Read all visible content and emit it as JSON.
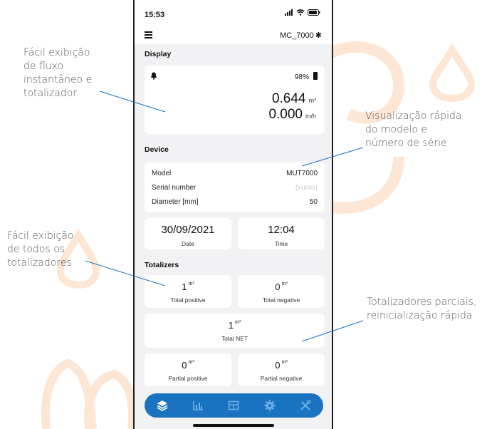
{
  "annotations": {
    "flow": "Fácil exibição\nde fluxo\ninstantâneo e\ntotalizador",
    "model": "Visualização rápida\ndo modelo e\nnúmero de série",
    "totalizers": "Fácil exibição\nde todos os\ntotalizadores",
    "partial": "Totalizadores parciais,\nreinicialização rápida"
  },
  "status": {
    "time": "15:53"
  },
  "appbar": {
    "device_id": "MC_7000"
  },
  "display": {
    "title": "Display",
    "battery": "98%",
    "volume": "0.644",
    "volume_unit": "m³",
    "flow": "0.000",
    "flow_unit": "m/h"
  },
  "device": {
    "title": "Device",
    "model_label": "Model",
    "model_value": "MUT7000",
    "serial_label": "Serial number",
    "serial_value": "(vuoto)",
    "diameter_label": "Diameter [mm]",
    "diameter_value": "50",
    "date_value": "30/09/2021",
    "date_label": "Date",
    "time_value": "12:04",
    "time_label": "Time"
  },
  "totalizers": {
    "title": "Totalizers",
    "unit": "m³",
    "positive_value": "1",
    "positive_label": "Total positive",
    "negative_value": "0",
    "negative_label": "Total negative",
    "net_value": "1",
    "net_label": "Total NET",
    "partial_pos_value": "0",
    "partial_pos_label": "Partial positive",
    "partial_neg_value": "0",
    "partial_neg_label": "Partial negative"
  },
  "nav": {
    "items": [
      "layers-icon",
      "bar-chart-icon",
      "table-icon",
      "gear-icon",
      "tools-icon"
    ]
  },
  "colors": {
    "accent": "#1a73c0",
    "deco": "#fde6d4"
  }
}
